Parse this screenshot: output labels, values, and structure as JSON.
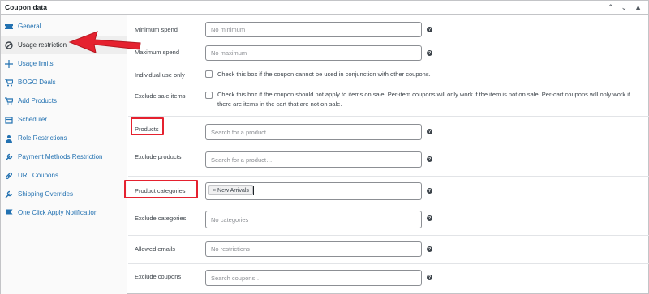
{
  "panel": {
    "title": "Coupon data"
  },
  "header_icons": [
    "chevron-up-icon",
    "chevron-down-icon",
    "caret-up-icon"
  ],
  "tabs": [
    {
      "label": "General",
      "icon": "ticket-icon",
      "active": false
    },
    {
      "label": "Usage restriction",
      "icon": "block-icon",
      "active": true
    },
    {
      "label": "Usage limits",
      "icon": "plus-cross-icon",
      "active": false
    },
    {
      "label": "BOGO Deals",
      "icon": "cart-icon",
      "active": false
    },
    {
      "label": "Add Products",
      "icon": "cart-icon",
      "active": false
    },
    {
      "label": "Scheduler",
      "icon": "calendar-icon",
      "active": false
    },
    {
      "label": "Role Restrictions",
      "icon": "person-icon",
      "active": false
    },
    {
      "label": "Payment Methods Restriction",
      "icon": "wrench-icon",
      "active": false
    },
    {
      "label": "URL Coupons",
      "icon": "link-icon",
      "active": false
    },
    {
      "label": "Shipping Overrides",
      "icon": "wrench-icon",
      "active": false
    },
    {
      "label": "One Click Apply Notification",
      "icon": "flag-icon",
      "active": false
    }
  ],
  "fields": {
    "minimum_spend": {
      "label": "Minimum spend",
      "placeholder": "No minimum"
    },
    "maximum_spend": {
      "label": "Maximum spend",
      "placeholder": "No maximum"
    },
    "individual_use": {
      "label": "Individual use only",
      "text": "Check this box if the coupon cannot be used in conjunction with other coupons."
    },
    "exclude_sale": {
      "label": "Exclude sale items",
      "text_line1": "Check this box if the coupon should not apply to items on sale. Per-item coupons will only work if the item is not on sale. Per-cart coupons will only work if",
      "text_line2": "there are items in the cart that are not on sale."
    },
    "products": {
      "label": "Products",
      "placeholder": "Search for a product…"
    },
    "exclude_products": {
      "label": "Exclude products",
      "placeholder": "Search for a product…"
    },
    "product_categories": {
      "label": "Product categories",
      "tag": "× New Arrivals"
    },
    "exclude_categories": {
      "label": "Exclude categories",
      "placeholder": "No categories"
    },
    "allowed_emails": {
      "label": "Allowed emails",
      "placeholder": "No restrictions"
    },
    "exclude_coupons": {
      "label": "Exclude coupons",
      "placeholder": "Search coupons…"
    }
  },
  "help_glyph": "?",
  "annotation_color": "#e5212f"
}
